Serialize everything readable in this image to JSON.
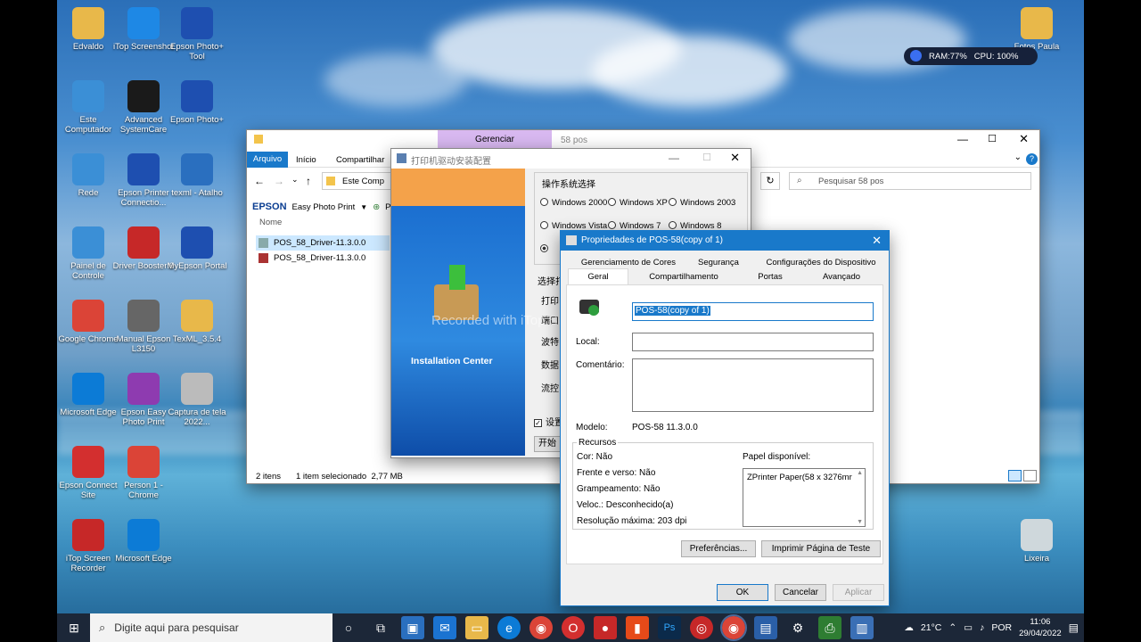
{
  "desktop_icons": [
    {
      "label": "Edvaldo",
      "icon": "user-folder-icon",
      "color": "#e8b84a"
    },
    {
      "label": "iTop Screenshot",
      "icon": "camera-icon",
      "color": "#1e88e5"
    },
    {
      "label": "Epson Photo+ Tool",
      "icon": "photo-tool-icon",
      "color": "#1e4fb0"
    },
    {
      "label": "Este Computador",
      "icon": "computer-icon",
      "color": "#3b8fd6"
    },
    {
      "label": "Advanced SystemCare",
      "icon": "systemcare-icon",
      "color": "#1a1a1a"
    },
    {
      "label": "Epson Photo+",
      "icon": "photo-plus-icon",
      "color": "#1e4fb0"
    },
    {
      "label": "Rede",
      "icon": "network-icon",
      "color": "#3b8fd6"
    },
    {
      "label": "Epson Printer Connectio...",
      "icon": "printer-icon",
      "color": "#1e4fb0"
    },
    {
      "label": "texml - Atalho",
      "icon": "document-icon",
      "color": "#2a6fbf"
    },
    {
      "label": "Painel de Controle",
      "icon": "control-panel-icon",
      "color": "#3b8fd6"
    },
    {
      "label": "Driver Booster 9",
      "icon": "driver-booster-icon",
      "color": "#c62828"
    },
    {
      "label": "MyEpson Portal",
      "icon": "info-icon",
      "color": "#1e4fb0"
    },
    {
      "label": "Google Chrome",
      "icon": "chrome-icon",
      "color": "#db4437"
    },
    {
      "label": "Manual Epson L3150",
      "icon": "manual-icon",
      "color": "#666"
    },
    {
      "label": "TexML_3.5.4",
      "icon": "folder-icon",
      "color": "#e8b84a"
    },
    {
      "label": "Microsoft Edge",
      "icon": "edge-icon",
      "color": "#0c7bd6"
    },
    {
      "label": "Epson Easy Photo Print",
      "icon": "easy-photo-icon",
      "color": "#8e3bb0"
    },
    {
      "label": "Captura de tela 2022...",
      "icon": "screenshot-icon",
      "color": "#bbb"
    },
    {
      "label": "Epson Connect Site",
      "icon": "opera-icon",
      "color": "#d32f2f"
    },
    {
      "label": "Person 1 - Chrome",
      "icon": "chrome-profile-icon",
      "color": "#db4437"
    },
    {
      "label": "iTop Screen Recorder",
      "icon": "recorder-icon",
      "color": "#c62828"
    },
    {
      "label": "Microsoft Edge",
      "icon": "edge-icon",
      "color": "#0c7bd6"
    },
    {
      "label": "Fotos Paula",
      "icon": "folder-icon",
      "color": "#e8b84a"
    },
    {
      "label": "Lixeira",
      "icon": "recycle-bin-icon",
      "color": "#cfd8dc"
    }
  ],
  "perf_widget": {
    "ram": "RAM:77%",
    "cpu": "CPU: 100%"
  },
  "explorer": {
    "ribbon_context": "Gerenciar",
    "title": "58 pos",
    "tabs": [
      "Arquivo",
      "Início",
      "Compartilhar"
    ],
    "address": "Este Comp",
    "search_placeholder": "Pesquisar 58 pos",
    "toolbar": {
      "brand": "EPSON",
      "app": "Easy Photo Print",
      "extra": "Pl"
    },
    "column": "Nome",
    "files": [
      "POS_58_Driver-11.3.0.0",
      "POS_58_Driver-11.3.0.0"
    ],
    "status": {
      "items": "2 itens",
      "selected": "1 item selecionado  2,77 MB"
    }
  },
  "installer": {
    "title": "打印机驱动安装配置",
    "banner": "Installation Center",
    "os_group": "操作系统选择",
    "os_options": [
      "Windows 2000",
      "Windows XP",
      "Windows 2003",
      "Windows Vista",
      "Windows 7",
      "Windows 8"
    ],
    "side_labels": [
      "选择打",
      "打印",
      "端口",
      "波特",
      "数据",
      "流控"
    ],
    "checkbox": "设置",
    "button": "开始安"
  },
  "watermark": "Recorded with iTop Screen Recorder",
  "props": {
    "title": "Propriedades de POS-58(copy of 1)",
    "tabs_row1": [
      "Gerenciamento de Cores",
      "Segurança",
      "Configurações do Dispositivo"
    ],
    "tabs_row2": [
      "Geral",
      "Compartilhamento",
      "Portas",
      "Avançado"
    ],
    "name_value": "POS-58(copy of 1)",
    "local_label": "Local:",
    "comment_label": "Comentário:",
    "model_label": "Modelo:",
    "model_value": "POS-58 11.3.0.0",
    "features_title": "Recursos",
    "features": [
      "Cor: Não",
      "Frente e verso: Não",
      "Grampeamento: Não",
      "Veloc.: Desconhecido(a)",
      "Resolução máxima: 203 dpi"
    ],
    "paper_label": "Papel disponível:",
    "paper_value": "ZPrinter Paper(58 x 3276mr",
    "pref_button": "Preferências...",
    "test_button": "Imprimir Página de Teste",
    "ok": "OK",
    "cancel": "Cancelar",
    "apply": "Aplicar"
  },
  "taskbar": {
    "search_placeholder": "Digite aqui para pesquisar",
    "weather": "21°C",
    "lang": "POR",
    "time": "11:06",
    "date": "29/04/2022"
  }
}
